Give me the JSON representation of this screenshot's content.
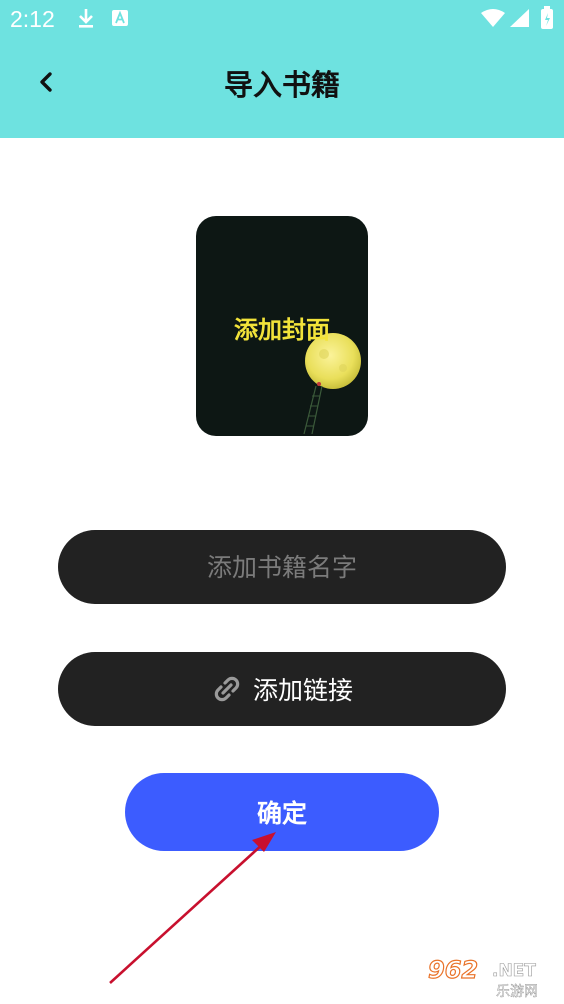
{
  "status_bar": {
    "time": "2:12",
    "icons": [
      "download-icon",
      "app-notification-icon",
      "wifi-icon",
      "cellular-signal-icon",
      "battery-icon"
    ]
  },
  "header": {
    "title": "导入书籍",
    "back_icon": "chevron-left-icon",
    "background_color": "#6ee2e0"
  },
  "cover": {
    "label": "添加封面"
  },
  "book_name": {
    "placeholder": "添加书籍名字",
    "value": ""
  },
  "link": {
    "icon": "link-icon",
    "label": "添加链接"
  },
  "confirm": {
    "label": "确定",
    "color": "#3c5cff"
  },
  "watermark": {
    "brand": "962.NET",
    "subtitle": "乐游网"
  }
}
